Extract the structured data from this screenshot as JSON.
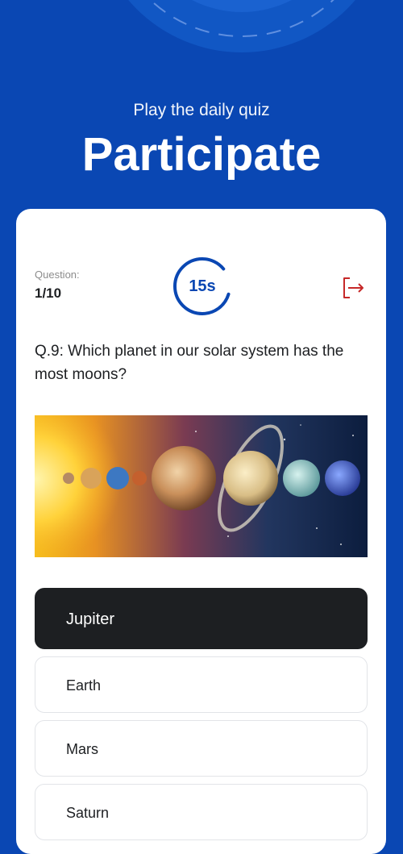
{
  "header": {
    "subtitle": "Play the daily quiz",
    "title": "Participate"
  },
  "quiz": {
    "progress_label": "Question:",
    "progress_value": "1/10",
    "timer_text": "15s",
    "question_text": "Q.9: Which planet in our solar system has the most moons?",
    "image_alt": "solar-system-planets",
    "answers": [
      {
        "label": "Jupiter",
        "selected": true
      },
      {
        "label": "Earth",
        "selected": false
      },
      {
        "label": "Mars",
        "selected": false
      },
      {
        "label": "Saturn",
        "selected": false
      }
    ]
  },
  "icons": {
    "exit": "exit-icon"
  },
  "colors": {
    "brand_blue": "#0a47b3",
    "card_background": "#ffffff",
    "selected_answer": "#1d1f22",
    "exit_icon": "#c62828",
    "muted_text": "#8c8c8c"
  }
}
